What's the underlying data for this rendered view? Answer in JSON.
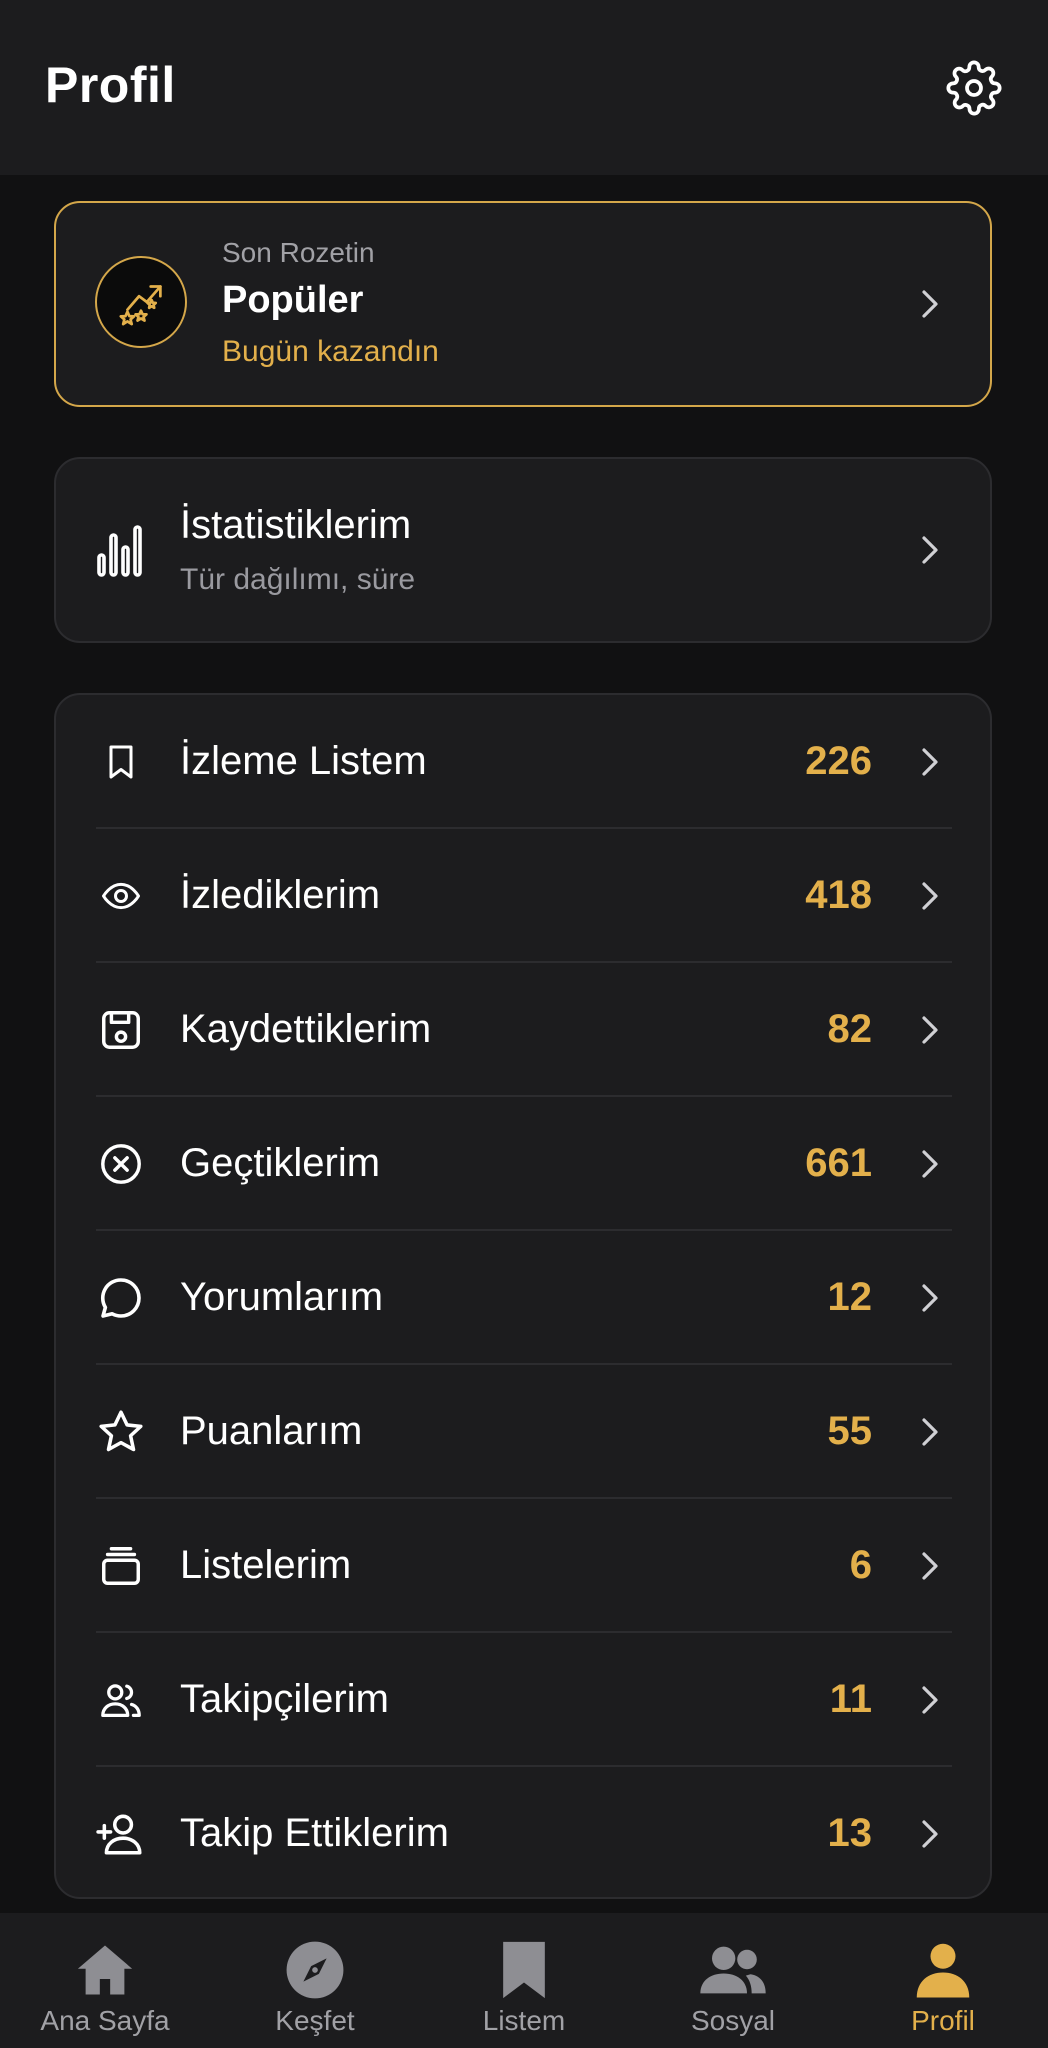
{
  "header": {
    "title": "Profil",
    "settings_icon": "gear-icon"
  },
  "latest_badge": {
    "caption": "Son Rozetin",
    "name": "Popüler",
    "earned": "Bugün kazandın",
    "icon": "trending-stars-icon",
    "accent": "#e3b04b"
  },
  "stats": {
    "title": "İstatistiklerim",
    "subtitle": "Tür dağılımı, süre",
    "icon": "bar-chart-icon"
  },
  "menu": [
    {
      "label": "İzleme Listem",
      "count": "226",
      "icon": "bookmark-icon"
    },
    {
      "label": "İzlediklerim",
      "count": "418",
      "icon": "eye-icon"
    },
    {
      "label": "Kaydettiklerim",
      "count": "82",
      "icon": "save-disk-icon"
    },
    {
      "label": "Geçtiklerim",
      "count": "661",
      "icon": "x-circle-icon"
    },
    {
      "label": "Yorumlarım",
      "count": "12",
      "icon": "chat-bubble-icon"
    },
    {
      "label": "Puanlarım",
      "count": "55",
      "icon": "star-icon"
    },
    {
      "label": "Listelerim",
      "count": "6",
      "icon": "stacked-cards-icon"
    },
    {
      "label": "Takipçilerim",
      "count": "11",
      "icon": "followers-icon"
    },
    {
      "label": "Takip Ettiklerim",
      "count": "13",
      "icon": "user-plus-icon"
    }
  ],
  "nav": [
    {
      "label": "Ana Sayfa",
      "icon": "home-icon",
      "active": false
    },
    {
      "label": "Keşfet",
      "icon": "compass-icon",
      "active": false
    },
    {
      "label": "Listem",
      "icon": "bookmark-icon",
      "active": false
    },
    {
      "label": "Sosyal",
      "icon": "people-icon",
      "active": false
    },
    {
      "label": "Profil",
      "icon": "person-icon",
      "active": true
    }
  ],
  "colors": {
    "accent": "#e3b04b",
    "background": "#111112",
    "surface": "#1c1c1e"
  }
}
